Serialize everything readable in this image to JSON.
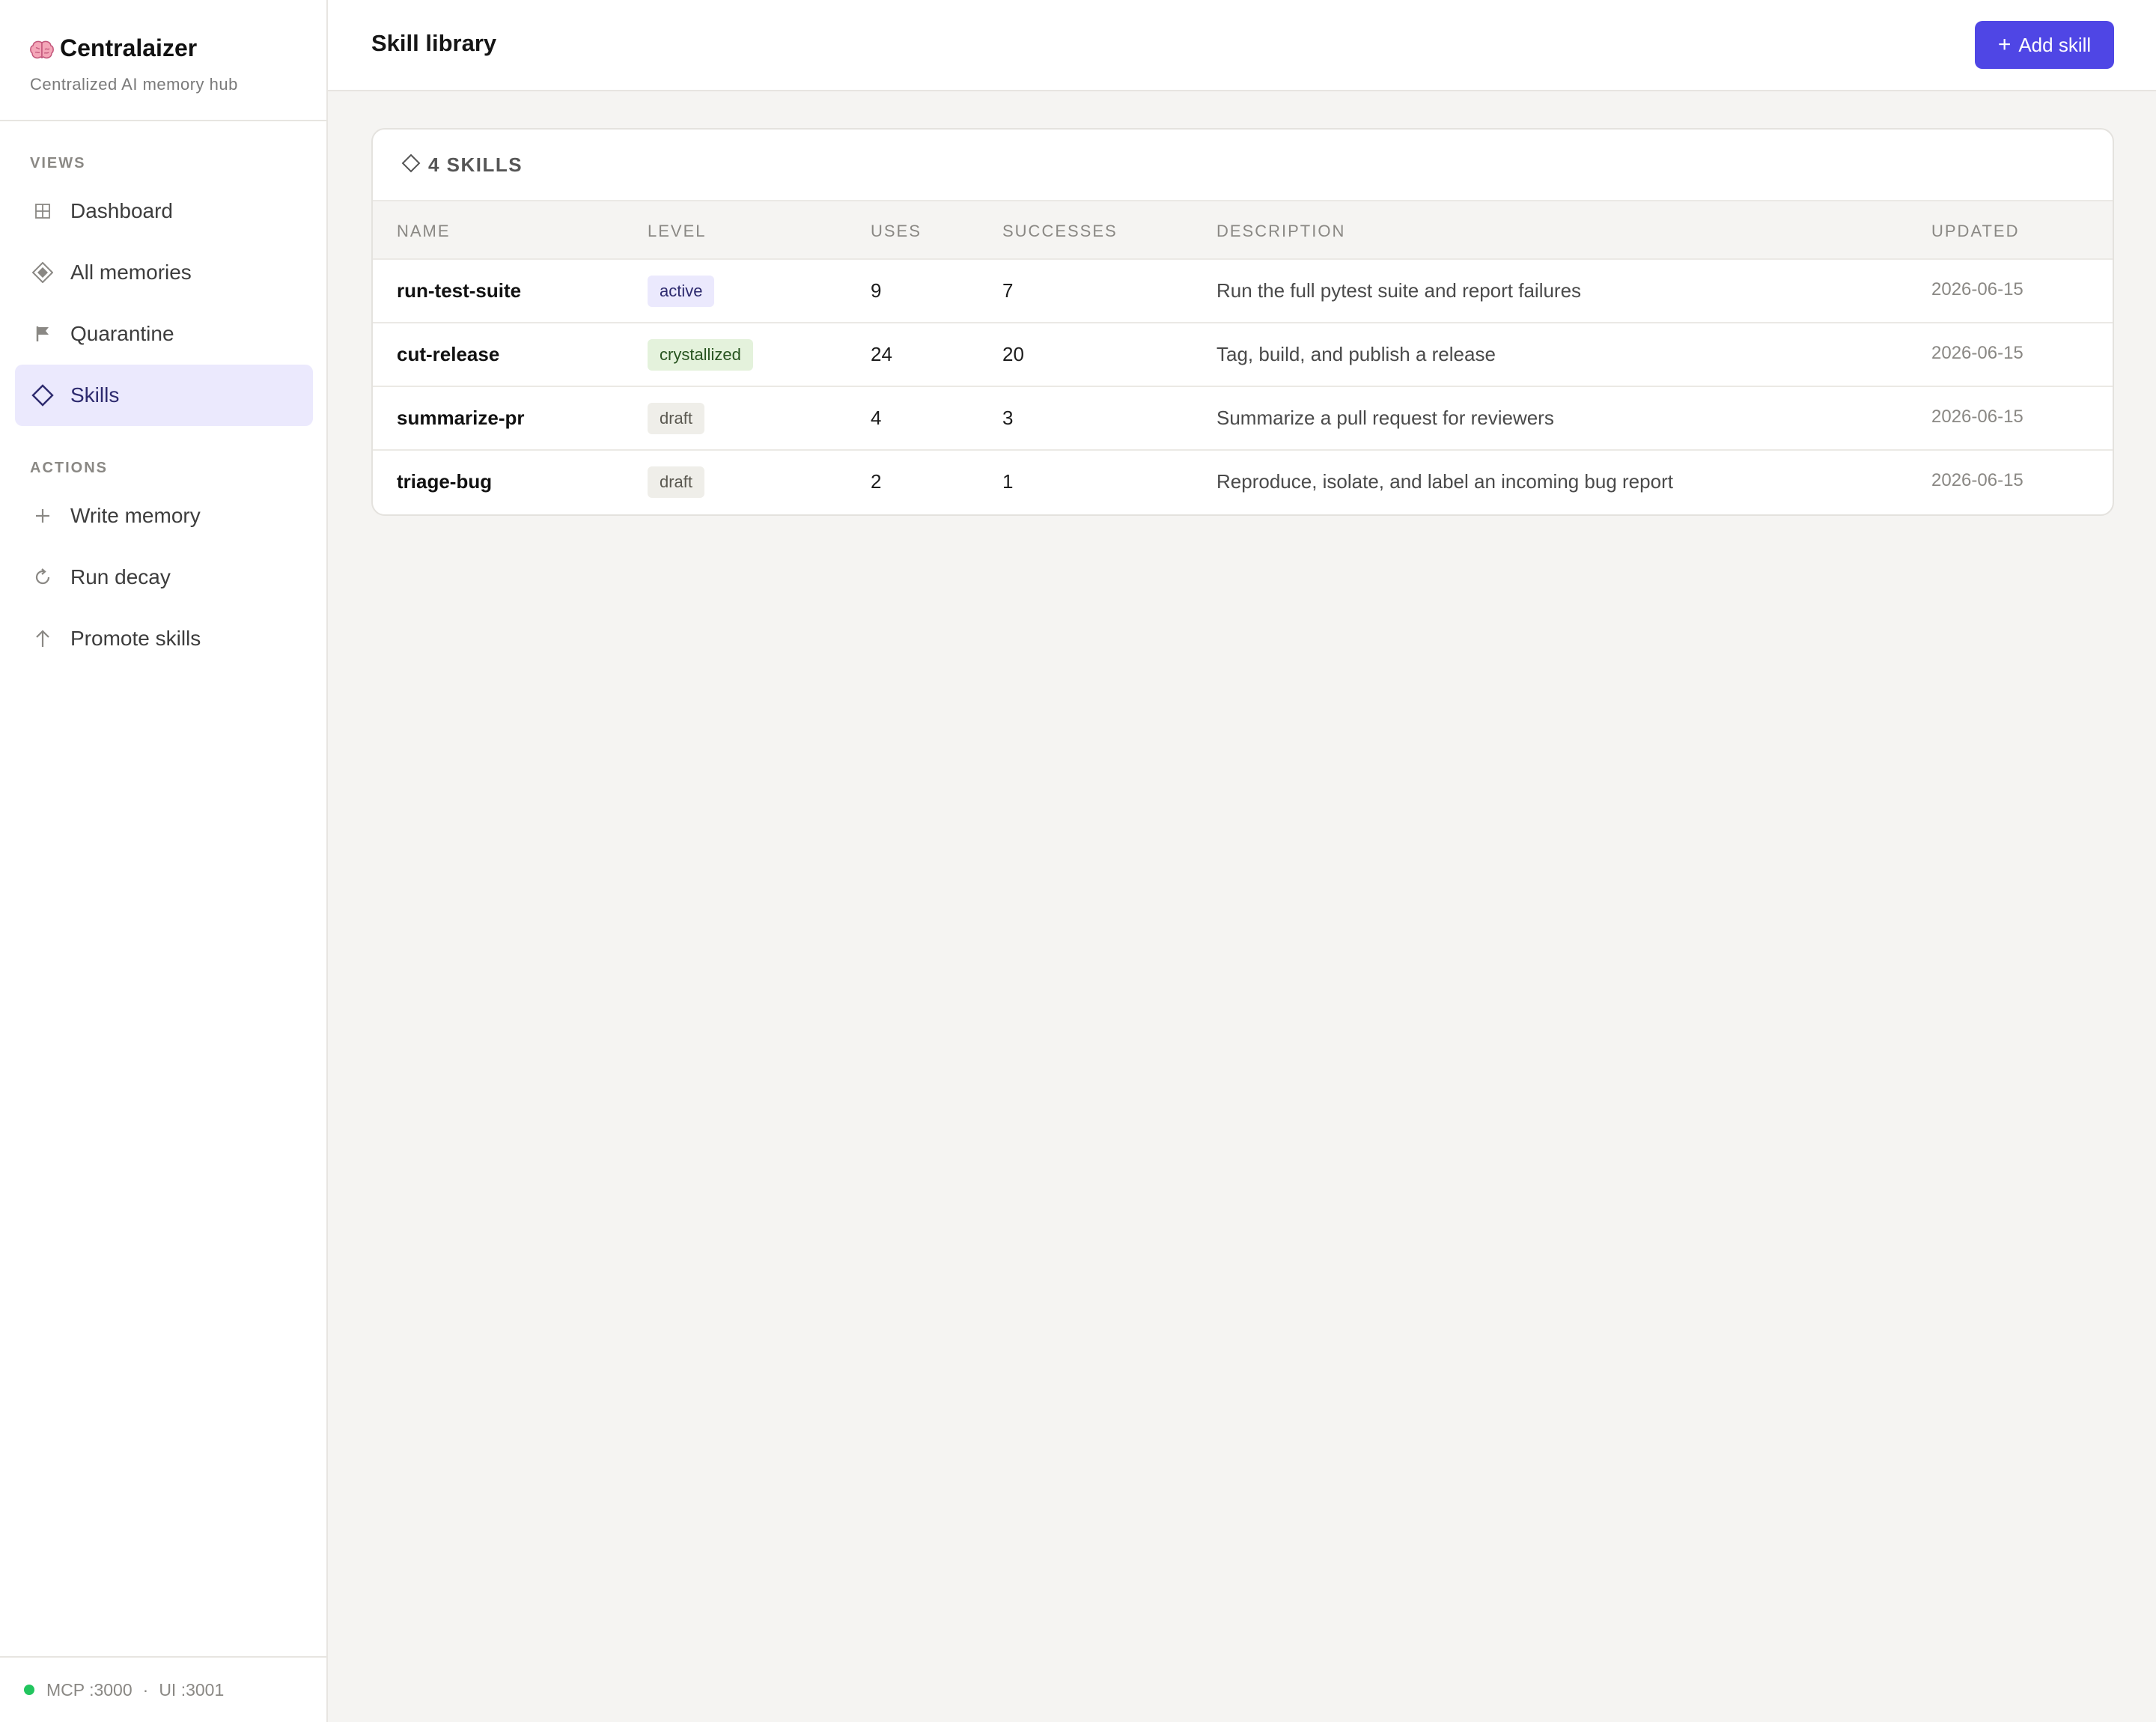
{
  "brand": {
    "title": "Centralaizer",
    "subtitle": "Centralized AI memory hub",
    "icon": "brain-icon"
  },
  "sidebar": {
    "views_label": "VIEWS",
    "views": [
      {
        "label": "Dashboard",
        "icon": "grid-icon",
        "active": false
      },
      {
        "label": "All memories",
        "icon": "diamond-filled-icon",
        "active": false
      },
      {
        "label": "Quarantine",
        "icon": "flag-icon",
        "active": false
      },
      {
        "label": "Skills",
        "icon": "diamond-outline-icon",
        "active": true
      }
    ],
    "actions_label": "ACTIONS",
    "actions": [
      {
        "label": "Write memory",
        "icon": "plus-icon"
      },
      {
        "label": "Run decay",
        "icon": "refresh-icon"
      },
      {
        "label": "Promote skills",
        "icon": "arrow-up-icon"
      }
    ],
    "footer": {
      "mcp": "MCP :3000",
      "separator": "·",
      "ui": "UI :3001",
      "status_color": "#22c55e"
    }
  },
  "header": {
    "title": "Skill library",
    "add_button": "Add skill"
  },
  "skills": {
    "count_label": "4 SKILLS",
    "columns": [
      "NAME",
      "LEVEL",
      "USES",
      "SUCCESSES",
      "DESCRIPTION",
      "UPDATED"
    ],
    "rows": [
      {
        "name": "run-test-suite",
        "level": "active",
        "uses": "9",
        "successes": "7",
        "description": "Run the full pytest suite and report failures",
        "updated": "2026-06-15"
      },
      {
        "name": "cut-release",
        "level": "crystallized",
        "uses": "24",
        "successes": "20",
        "description": "Tag, build, and publish a release",
        "updated": "2026-06-15"
      },
      {
        "name": "summarize-pr",
        "level": "draft",
        "uses": "4",
        "successes": "3",
        "description": "Summarize a pull request for reviewers",
        "updated": "2026-06-15"
      },
      {
        "name": "triage-bug",
        "level": "draft",
        "uses": "2",
        "successes": "1",
        "description": "Reproduce, isolate, and label an incoming bug report",
        "updated": "2026-06-15"
      }
    ]
  },
  "colors": {
    "accent": "#4f46e5",
    "active_nav_bg": "#ebe9fd",
    "status_online": "#22c55e"
  }
}
